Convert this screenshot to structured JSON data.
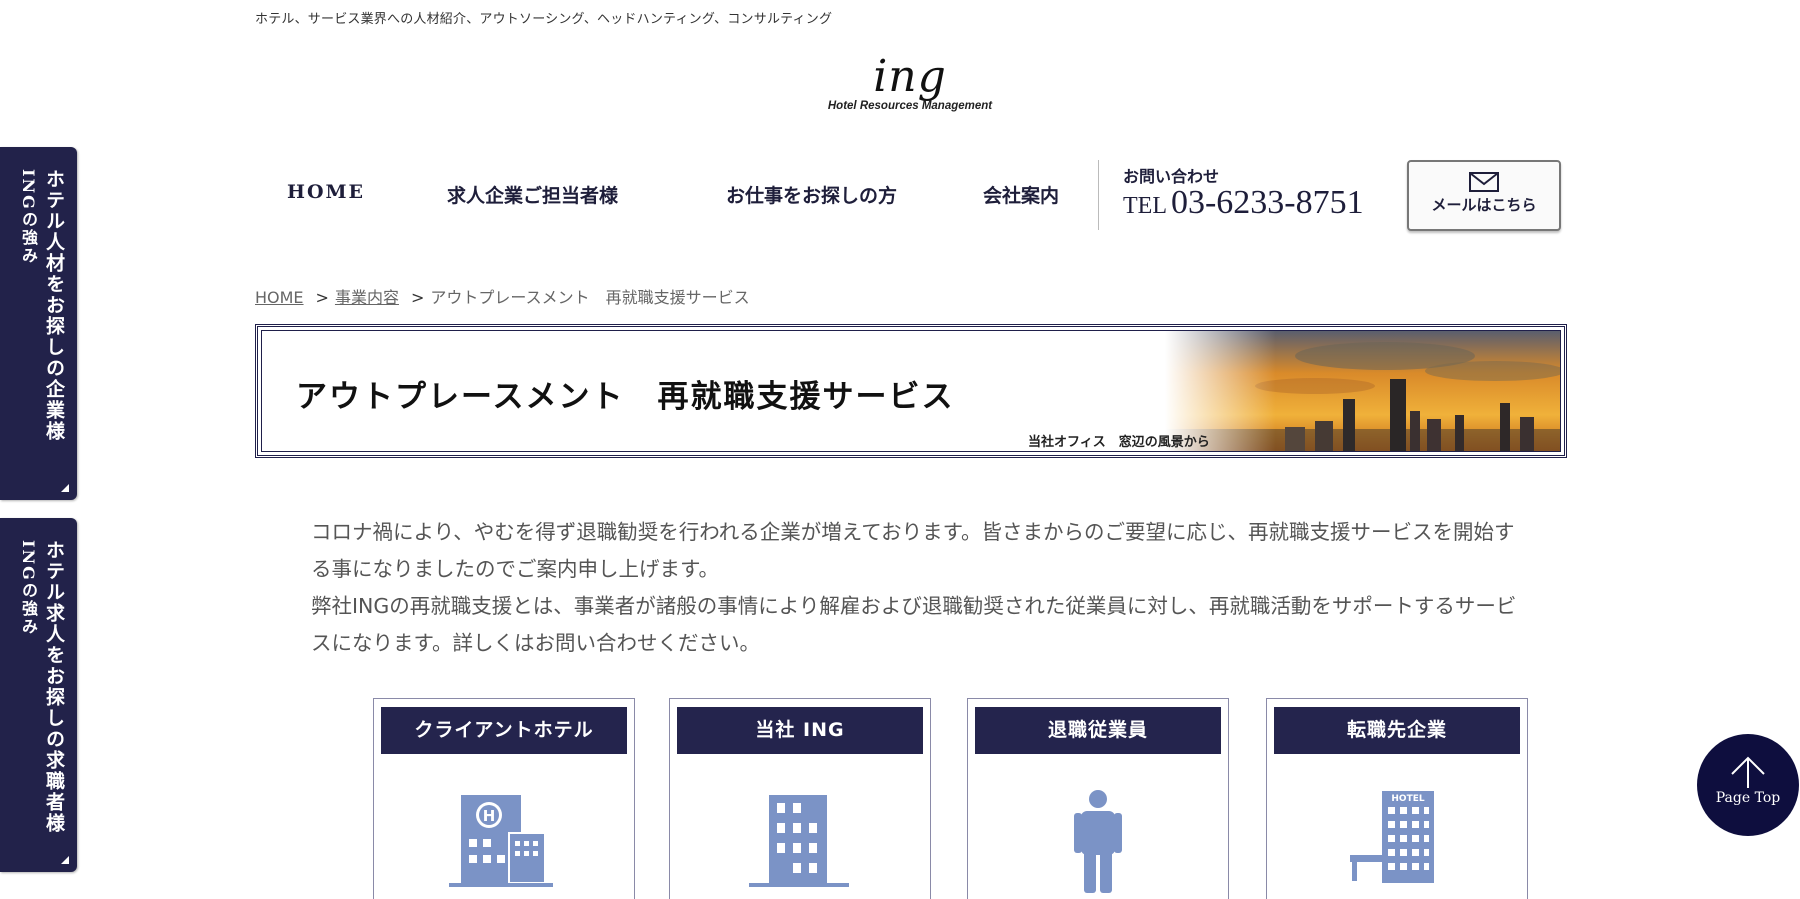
{
  "header": {
    "tagline": "ホテル、サービス業界への人材紹介、アウトソーシング、ヘッドハンティング、コンサルティング",
    "logo_text": "ing",
    "logo_subtitle": "Hotel Resources Management"
  },
  "nav": {
    "items": [
      {
        "label": "HOME"
      },
      {
        "label": "求人企業ご担当者様"
      },
      {
        "label": "お仕事をお探しの方"
      },
      {
        "label": "会社案内"
      }
    ]
  },
  "contact": {
    "label": "お問い合わせ",
    "tel_prefix": "TEL",
    "tel_number": "03-6233-8751",
    "mail_label": "メールはこちら"
  },
  "breadcrumb": {
    "items": [
      "HOME",
      "事業内容",
      "アウトプレースメント　再就職支援サービス"
    ],
    "separator": ">"
  },
  "hero": {
    "title": "アウトプレースメント　再就職支援サービス",
    "caption": "当社オフィス　窓辺の風景から"
  },
  "intro": {
    "p1": "コロナ禍により、やむを得ず退職勧奨を行われる企業が増えております。皆さまからのご要望に応じ、再就職支援サービスを開始する事になりましたのでご案内申し上げます。",
    "p2": "弊社INGの再就職支援とは、事業者が諸般の事情により解雇および退職勧奨された従業員に対し、再就職活動をサポートするサービスになります。詳しくはお問い合わせください。"
  },
  "cards": [
    {
      "label": "クライアントホテル",
      "icon": "hotel-building-icon"
    },
    {
      "label": "当社 ING",
      "icon": "office-building-icon"
    },
    {
      "label": "退職従業員",
      "icon": "person-icon"
    },
    {
      "label": "転職先企業",
      "icon": "hotel-sign-building-icon"
    }
  ],
  "side_tabs": [
    {
      "main": "ホテル人材をお探しの企業様",
      "sub": "INGの強み"
    },
    {
      "main": "ホテル求人をお探しの求職者様",
      "sub": "INGの強み"
    }
  ],
  "page_top": {
    "label": "Page Top"
  },
  "colors": {
    "navy": "#22224a",
    "icon_blue": "#7b93c6",
    "text": "#555555"
  }
}
